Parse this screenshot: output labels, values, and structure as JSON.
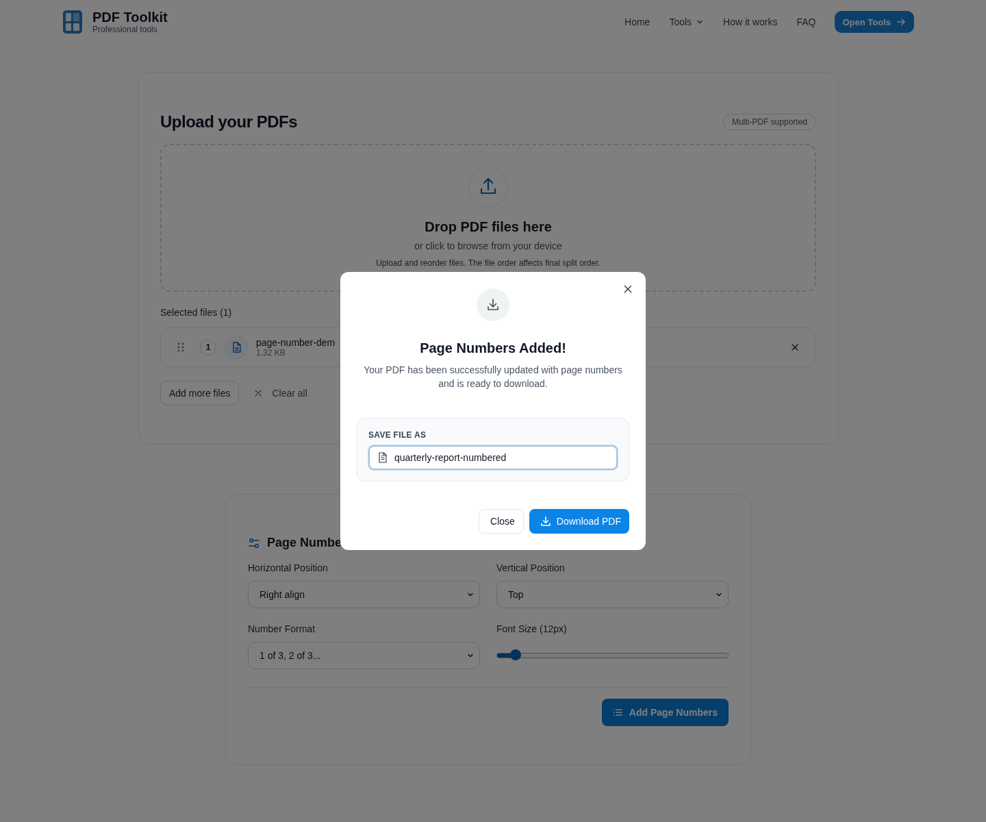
{
  "header": {
    "logo_title": "PDF Toolkit",
    "logo_subtitle": "Professional tools",
    "nav": [
      {
        "label": "Home",
        "kind": "link"
      },
      {
        "label": "Tools",
        "kind": "dropdown"
      },
      {
        "label": "How it works",
        "kind": "link"
      },
      {
        "label": "FAQ",
        "kind": "link"
      }
    ],
    "cta": "Open Tools"
  },
  "upload": {
    "title": "Upload your PDFs",
    "badge": "Multi-PDF supported",
    "dropzone": {
      "title": "Drop PDF files here",
      "subtitle": "or click to browse from your device",
      "hint": "Upload and reorder files. The file order affects final split order."
    },
    "selected_label": "Selected files (1)",
    "files": [
      {
        "index": "1",
        "name": "page-number-dem",
        "size": "1.32 KB"
      }
    ],
    "add_more": "Add more files",
    "clear_all": "Clear all"
  },
  "settings": {
    "title": "Page Numbe",
    "fields": [
      {
        "kind": "select",
        "label": "Horizontal Position",
        "value": "Right align"
      },
      {
        "kind": "select",
        "label": "Vertical Position",
        "value": "Top"
      },
      {
        "kind": "select",
        "label": "Number Format",
        "value": "1 of 3, 2 of 3..."
      },
      {
        "kind": "slider",
        "label": "Font Size (12px)",
        "level": 0.08
      }
    ],
    "submit": "Add Page Numbers"
  },
  "modal": {
    "title": "Page Numbers Added!",
    "message": "Your PDF has been successfully updated with page numbers and is ready to download.",
    "save_label": "SAVE FILE AS",
    "filename": "quarterly-report-numbered",
    "buttons": [
      {
        "label": "Close",
        "kind": "secondary"
      },
      {
        "label": "Download PDF",
        "kind": "primary"
      }
    ]
  }
}
